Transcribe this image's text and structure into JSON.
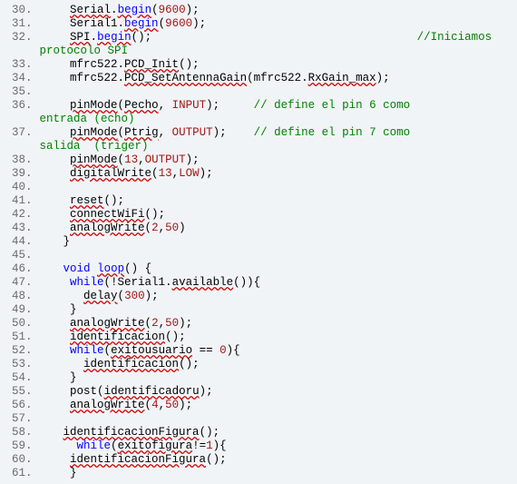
{
  "lines": [
    {
      "n": 30,
      "seg": [
        {
          "t": "     ",
          "c": ""
        },
        {
          "t": "Serial",
          "c": "sq"
        },
        {
          "t": ".",
          "c": ""
        },
        {
          "t": "begin",
          "c": "kw sq"
        },
        {
          "t": "(",
          "c": ""
        },
        {
          "t": "9600",
          "c": "lit"
        },
        {
          "t": ");",
          "c": ""
        }
      ]
    },
    {
      "n": 31,
      "seg": [
        {
          "t": "     ",
          "c": ""
        },
        {
          "t": "Serial1.",
          "c": ""
        },
        {
          "t": "begin",
          "c": "kw sq"
        },
        {
          "t": "(",
          "c": ""
        },
        {
          "t": "9600",
          "c": "lit"
        },
        {
          "t": ");",
          "c": ""
        }
      ]
    },
    {
      "n": 32,
      "seg": [
        {
          "t": "     ",
          "c": ""
        },
        {
          "t": "SPI",
          "c": "sq"
        },
        {
          "t": ".",
          "c": ""
        },
        {
          "t": "begin",
          "c": "kw sq"
        },
        {
          "t": "();                                       ",
          "c": ""
        },
        {
          "t": "//Iniciamos",
          "c": "cm"
        }
      ],
      "wrap": " protocolo SPI"
    },
    {
      "n": 33,
      "seg": [
        {
          "t": "     ",
          "c": ""
        },
        {
          "t": "mfrc522.",
          "c": ""
        },
        {
          "t": "PCD_Init",
          "c": "sq"
        },
        {
          "t": "();",
          "c": ""
        }
      ]
    },
    {
      "n": 34,
      "seg": [
        {
          "t": "     ",
          "c": ""
        },
        {
          "t": "mfrc522.",
          "c": ""
        },
        {
          "t": "PCD_SetAntennaGain",
          "c": "sq"
        },
        {
          "t": "(mfrc522.",
          "c": ""
        },
        {
          "t": "RxGain_max",
          "c": "sq"
        },
        {
          "t": ");",
          "c": ""
        }
      ]
    },
    {
      "n": 35,
      "seg": []
    },
    {
      "n": 36,
      "seg": [
        {
          "t": "     ",
          "c": ""
        },
        {
          "t": "pinMode",
          "c": "sq"
        },
        {
          "t": "(",
          "c": ""
        },
        {
          "t": "Pecho",
          "c": "sq"
        },
        {
          "t": ", ",
          "c": ""
        },
        {
          "t": "INPUT",
          "c": "lit"
        },
        {
          "t": ");     ",
          "c": ""
        },
        {
          "t": "// define el pin 6 como",
          "c": "cm"
        }
      ],
      "wrap": " entrada (echo)"
    },
    {
      "n": 37,
      "seg": [
        {
          "t": "     ",
          "c": ""
        },
        {
          "t": "pinMode",
          "c": "sq"
        },
        {
          "t": "(",
          "c": ""
        },
        {
          "t": "Ptrig",
          "c": "sq"
        },
        {
          "t": ", ",
          "c": ""
        },
        {
          "t": "OUTPUT",
          "c": "lit"
        },
        {
          "t": ");    ",
          "c": ""
        },
        {
          "t": "// define el pin 7 como",
          "c": "cm"
        }
      ],
      "wrap": " salida  (triger)"
    },
    {
      "n": 38,
      "seg": [
        {
          "t": "     ",
          "c": ""
        },
        {
          "t": "pinMode",
          "c": "sq"
        },
        {
          "t": "(",
          "c": ""
        },
        {
          "t": "13",
          "c": "lit"
        },
        {
          "t": ",",
          "c": ""
        },
        {
          "t": "OUTPUT",
          "c": "lit"
        },
        {
          "t": ");",
          "c": ""
        }
      ]
    },
    {
      "n": 39,
      "seg": [
        {
          "t": "     ",
          "c": ""
        },
        {
          "t": "digitalWrite",
          "c": "sq"
        },
        {
          "t": "(",
          "c": ""
        },
        {
          "t": "13",
          "c": "lit"
        },
        {
          "t": ",",
          "c": ""
        },
        {
          "t": "LOW",
          "c": "lit"
        },
        {
          "t": ");",
          "c": ""
        }
      ]
    },
    {
      "n": 40,
      "seg": []
    },
    {
      "n": 41,
      "seg": [
        {
          "t": "     ",
          "c": ""
        },
        {
          "t": "reset",
          "c": "sq"
        },
        {
          "t": "();",
          "c": ""
        }
      ]
    },
    {
      "n": 42,
      "seg": [
        {
          "t": "     ",
          "c": ""
        },
        {
          "t": "connectWiFi",
          "c": "sq"
        },
        {
          "t": "();",
          "c": ""
        }
      ]
    },
    {
      "n": 43,
      "seg": [
        {
          "t": "     ",
          "c": ""
        },
        {
          "t": "analogWrite",
          "c": "sq"
        },
        {
          "t": "(",
          "c": ""
        },
        {
          "t": "2",
          "c": "lit"
        },
        {
          "t": ",",
          "c": ""
        },
        {
          "t": "50",
          "c": "lit"
        },
        {
          "t": ")",
          "c": ""
        }
      ]
    },
    {
      "n": 44,
      "seg": [
        {
          "t": "    }",
          "c": ""
        }
      ]
    },
    {
      "n": 45,
      "seg": []
    },
    {
      "n": 46,
      "seg": [
        {
          "t": "    ",
          "c": ""
        },
        {
          "t": "void",
          "c": "kw"
        },
        {
          "t": " ",
          "c": ""
        },
        {
          "t": "loop",
          "c": "kw sq"
        },
        {
          "t": "() {",
          "c": ""
        }
      ]
    },
    {
      "n": 47,
      "seg": [
        {
          "t": "     ",
          "c": ""
        },
        {
          "t": "while",
          "c": "kw"
        },
        {
          "t": "(!Serial1.",
          "c": ""
        },
        {
          "t": "available",
          "c": "sq"
        },
        {
          "t": "()){",
          "c": ""
        }
      ]
    },
    {
      "n": 48,
      "seg": [
        {
          "t": "       ",
          "c": ""
        },
        {
          "t": "delay",
          "c": "sq"
        },
        {
          "t": "(",
          "c": ""
        },
        {
          "t": "300",
          "c": "lit"
        },
        {
          "t": ");",
          "c": ""
        }
      ]
    },
    {
      "n": 49,
      "seg": [
        {
          "t": "     }",
          "c": ""
        }
      ]
    },
    {
      "n": 50,
      "seg": [
        {
          "t": "     ",
          "c": ""
        },
        {
          "t": "analogWrite",
          "c": "sq"
        },
        {
          "t": "(",
          "c": ""
        },
        {
          "t": "2",
          "c": "lit"
        },
        {
          "t": ",",
          "c": ""
        },
        {
          "t": "50",
          "c": "lit"
        },
        {
          "t": ");",
          "c": ""
        }
      ]
    },
    {
      "n": 51,
      "seg": [
        {
          "t": "     ",
          "c": ""
        },
        {
          "t": "identificacion",
          "c": "sq"
        },
        {
          "t": "();",
          "c": ""
        }
      ]
    },
    {
      "n": 52,
      "seg": [
        {
          "t": "     ",
          "c": ""
        },
        {
          "t": "while",
          "c": "kw"
        },
        {
          "t": "(",
          "c": ""
        },
        {
          "t": "exitousuario",
          "c": "sq"
        },
        {
          "t": " == ",
          "c": ""
        },
        {
          "t": "0",
          "c": "lit"
        },
        {
          "t": "){",
          "c": ""
        }
      ]
    },
    {
      "n": 53,
      "seg": [
        {
          "t": "       ",
          "c": ""
        },
        {
          "t": "identificacion",
          "c": "sq"
        },
        {
          "t": "();",
          "c": ""
        }
      ]
    },
    {
      "n": 54,
      "seg": [
        {
          "t": "     }",
          "c": ""
        }
      ]
    },
    {
      "n": 55,
      "seg": [
        {
          "t": "     ",
          "c": ""
        },
        {
          "t": "post",
          "c": ""
        },
        {
          "t": "(",
          "c": ""
        },
        {
          "t": "identificadoru",
          "c": "sq"
        },
        {
          "t": ");",
          "c": ""
        }
      ]
    },
    {
      "n": 56,
      "seg": [
        {
          "t": "     ",
          "c": ""
        },
        {
          "t": "analogWrite",
          "c": "sq"
        },
        {
          "t": "(",
          "c": ""
        },
        {
          "t": "4",
          "c": "lit"
        },
        {
          "t": ",",
          "c": ""
        },
        {
          "t": "50",
          "c": "lit"
        },
        {
          "t": ");",
          "c": ""
        }
      ]
    },
    {
      "n": 57,
      "seg": []
    },
    {
      "n": 58,
      "seg": [
        {
          "t": "    ",
          "c": ""
        },
        {
          "t": "identificacionFigura",
          "c": "sq"
        },
        {
          "t": "();",
          "c": ""
        }
      ]
    },
    {
      "n": 59,
      "seg": [
        {
          "t": "      ",
          "c": ""
        },
        {
          "t": "while",
          "c": "kw"
        },
        {
          "t": "(",
          "c": ""
        },
        {
          "t": "exitofigura",
          "c": "sq"
        },
        {
          "t": "!=",
          "c": ""
        },
        {
          "t": "1",
          "c": "lit"
        },
        {
          "t": "){",
          "c": ""
        }
      ]
    },
    {
      "n": 60,
      "seg": [
        {
          "t": "     ",
          "c": ""
        },
        {
          "t": "identificacionFigura",
          "c": "sq"
        },
        {
          "t": "();",
          "c": ""
        }
      ]
    },
    {
      "n": 61,
      "seg": [
        {
          "t": "     }",
          "c": ""
        }
      ]
    }
  ]
}
